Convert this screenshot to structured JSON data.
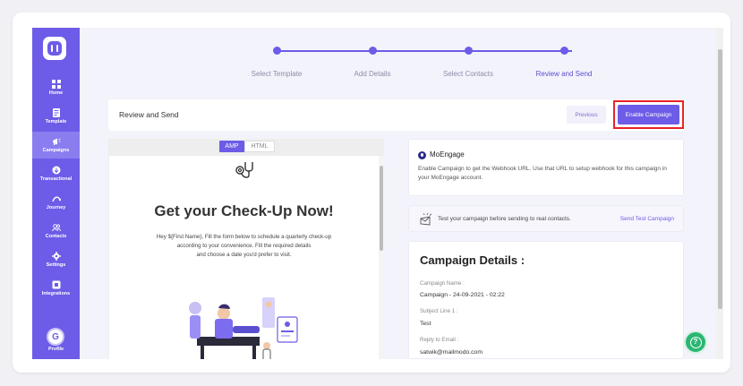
{
  "sidebar": {
    "items": [
      {
        "label": "Home",
        "icon": "grid-icon"
      },
      {
        "label": "Template",
        "icon": "template-icon"
      },
      {
        "label": "Campaigns",
        "icon": "megaphone-icon"
      },
      {
        "label": "Transactional",
        "icon": "transactional-icon"
      },
      {
        "label": "Journey",
        "icon": "journey-icon"
      },
      {
        "label": "Contacts",
        "icon": "contacts-icon"
      },
      {
        "label": "Settings",
        "icon": "gear-icon"
      },
      {
        "label": "Integrations",
        "icon": "integrations-icon"
      }
    ],
    "active": "Campaigns",
    "profile": {
      "initial": "G",
      "label": "Profile"
    }
  },
  "stepper": {
    "steps": [
      "Select Template",
      "Add Details",
      "Select Contacts",
      "Review and Send"
    ],
    "current": "Review and Send"
  },
  "header": {
    "title": "Review and Send",
    "previous_label": "Previous",
    "enable_label": "Enable Campaign"
  },
  "preview": {
    "tabs": [
      "AMP",
      "HTML"
    ],
    "active_tab": "AMP",
    "heading": "Get your Check-Up Now!",
    "body_line1": "Hey ${First Name}, Fill the form below to schedule a quarterly check-up",
    "body_line2": "according to your convenience. Fill the required details",
    "body_line3": "and choose a date you'd prefer to visit."
  },
  "moengage": {
    "title": "MoEngage",
    "description": "Enable Campaign to get the Webhook URL. Use that URL to setup webhook for this campaign in your MoEngage account."
  },
  "test": {
    "text": "Test your campaign before sending to real contacts.",
    "link": "Send Test Campaign"
  },
  "details": {
    "title": "Campaign Details :",
    "fields": [
      {
        "label": "Campaign Name :",
        "value": "Campaign - 24-09-2021 - 02:22"
      },
      {
        "label": "Subject Line 1 :",
        "value": "Test"
      },
      {
        "label": "Reply to Email :",
        "value": "satwik@mailmodo.com"
      }
    ]
  },
  "colors": {
    "brand": "#6c5ce7",
    "highlight": "#e8232a",
    "help": "#2bb673"
  }
}
